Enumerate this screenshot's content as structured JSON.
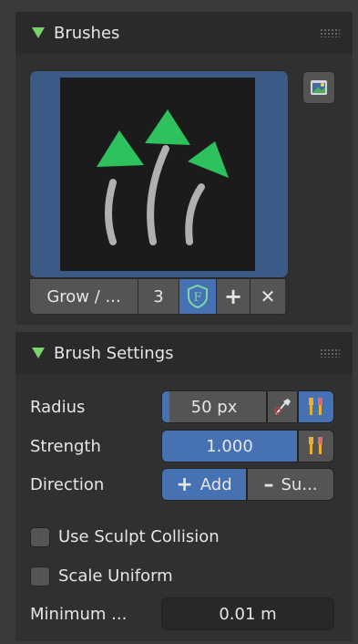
{
  "brushes_panel": {
    "title": "Brushes",
    "brush_name": "Grow / ...",
    "user_count": "3",
    "fake_user_label": "F",
    "add_label": "+",
    "delete_label": "✕",
    "preview_icon": "grow-brush-icon",
    "side_button_icon": "brush-image-icon"
  },
  "brush_settings_panel": {
    "title": "Brush Settings",
    "radius": {
      "label": "Radius",
      "value": "50 px",
      "fill_fraction": 0.05
    },
    "strength": {
      "label": "Strength",
      "value": "1.000",
      "fill_fraction": 1.0
    },
    "direction": {
      "label": "Direction",
      "add_label": "Add",
      "subtract_label": "Su...",
      "selected": "add"
    },
    "use_sculpt_collision": {
      "label": "Use Sculpt Collision",
      "checked": false
    },
    "scale_uniform": {
      "label": "Scale Uniform",
      "checked": false
    },
    "minimum": {
      "label": "Minimum ...",
      "value": "0.01 m"
    }
  },
  "colors": {
    "accent_blue": "#4672b4",
    "triangle_green": "#79d46b",
    "brush_green": "#2ec25e"
  }
}
